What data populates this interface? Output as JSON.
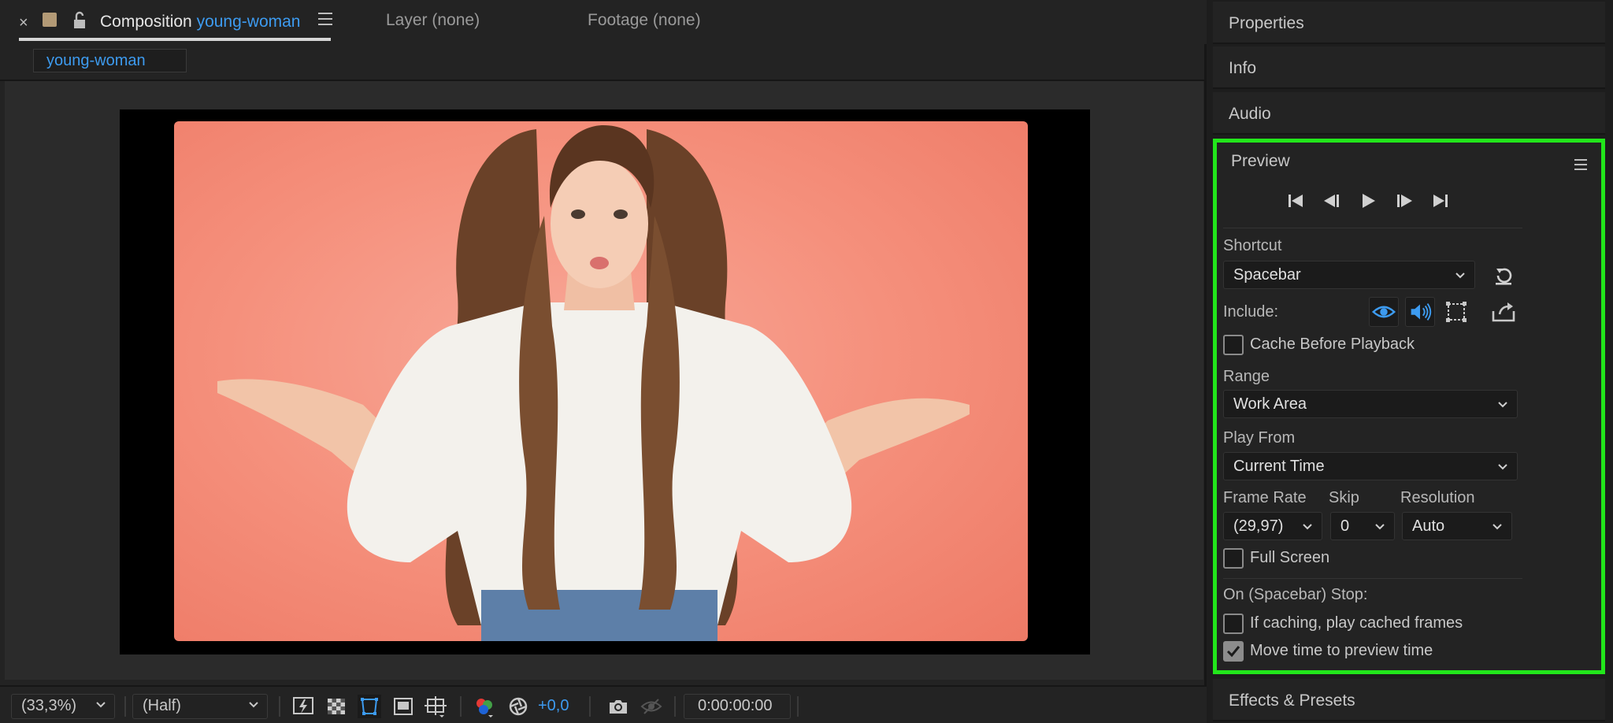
{
  "composition_panel": {
    "tab": {
      "close": "×",
      "title_prefix": "Composition",
      "comp_name": "young-woman"
    },
    "other_tabs": [
      "Layer (none)",
      "Footage (none)"
    ],
    "sub_tab": "young-woman",
    "viewer": {
      "image_description_icon": "portrait-photo"
    },
    "bottom_bar": {
      "magnification": "(33,3%)",
      "resolution": "(Half)",
      "exposure": "+0,0",
      "timecode": "0:00:00:00"
    }
  },
  "right_panels": {
    "properties": "Properties",
    "info": "Info",
    "audio": "Audio",
    "preview": {
      "title": "Preview",
      "shortcut_label": "Shortcut",
      "shortcut_value": "Spacebar",
      "include_label": "Include:",
      "cache_before_playback": "Cache Before Playback",
      "range_label": "Range",
      "range_value": "Work Area",
      "play_from_label": "Play From",
      "play_from_value": "Current Time",
      "frame_rate_label": "Frame Rate",
      "frame_rate_value": "(29,97)",
      "skip_label": "Skip",
      "skip_value": "0",
      "resolution_label": "Resolution",
      "resolution_value": "Auto",
      "full_screen": "Full Screen",
      "on_stop_label": "On (Spacebar) Stop:",
      "if_caching": "If caching, play cached frames",
      "move_time": "Move time to preview time",
      "checks": {
        "cache_before_playback": false,
        "full_screen": false,
        "if_caching": false,
        "move_time": true
      }
    },
    "effects_presets": "Effects & Presets"
  },
  "colors": {
    "accent": "#3d9bf0",
    "highlight_border": "#22e61b",
    "background_photo": "#f5907c"
  }
}
